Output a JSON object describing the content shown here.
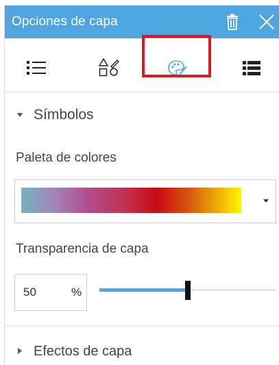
{
  "header": {
    "title": "Opciones de capa",
    "color": "#4ea5e0"
  },
  "tabs": [
    {
      "icon": "list-icon"
    },
    {
      "icon": "shapes-icon"
    },
    {
      "icon": "palette-icon",
      "selected": true
    },
    {
      "icon": "table-icon"
    }
  ],
  "sections": {
    "symbols": {
      "label": "Símbolos",
      "expanded": true
    },
    "effects": {
      "label": "Efectos de capa",
      "expanded": false
    }
  },
  "palette": {
    "label": "Paleta de colores",
    "gradient_colors": [
      "#75b3c0",
      "#a582b8",
      "#b04f8d",
      "#c2304c",
      "#c80a13",
      "#d8550f",
      "#efb200",
      "#fff700"
    ]
  },
  "transparency": {
    "label": "Transparencia de capa",
    "value": "50",
    "unit": "%",
    "slider_fraction": 0.5
  },
  "colors": {
    "accent": "#4aa8e8",
    "selection_frame": "#e0191e"
  }
}
